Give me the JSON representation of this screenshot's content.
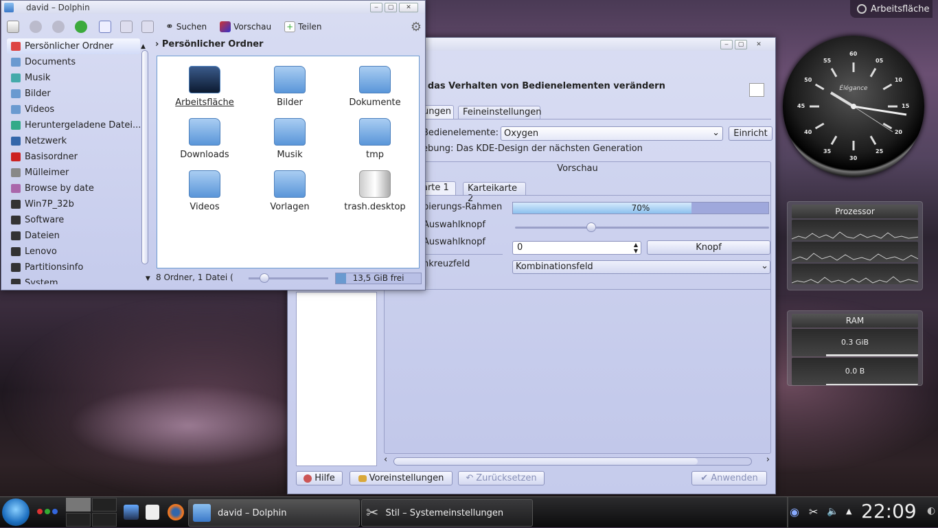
{
  "desktop": {
    "label": "Arbeitsfläche"
  },
  "clock_widget": {
    "brand": "Élégance",
    "numbers": [
      "60",
      "05",
      "10",
      "15",
      "20",
      "25",
      "30",
      "35",
      "40",
      "45",
      "50",
      "55"
    ]
  },
  "processor_widget": {
    "title": "Prozessor"
  },
  "ram_widget": {
    "title": "RAM",
    "values": [
      "0.3 GiB",
      "0.0 B"
    ]
  },
  "settings_window": {
    "heading": "d das Verhalten von Bedienelementen verändern",
    "tabs": [
      "ungen",
      "Feineinstellungen"
    ],
    "style_label": "Bedienelemente:",
    "style_value": "Oxygen",
    "configure_button": "Einricht",
    "description": "ebung: Das KDE-Design der nächsten Generation",
    "preview_title": "Vorschau",
    "preview_tabs": [
      "arte 1",
      "Karteikarte 2"
    ],
    "left_labels": [
      "pierungs-Rahmen",
      "Auswahlknopf",
      "Auswahlknopf",
      "nkreuzfeld"
    ],
    "progress_text": "70%",
    "progress_value": 0.7,
    "slider_value": 0.3,
    "spin_value": "0",
    "button_label": "Knopf",
    "combo_label": "Kombinationsfeld",
    "footer_buttons": [
      "Hilfe",
      "Voreinstellungen",
      "Zurücksetzen",
      "Anwenden"
    ]
  },
  "dolphin": {
    "title": "david – Dolphin",
    "toolbar": {
      "search": "Suchen",
      "preview": "Vorschau",
      "share": "Teilen"
    },
    "breadcrumb": "Persönlicher Ordner",
    "places": [
      "Persönlicher Ordner",
      "Documents",
      "Musik",
      "Bilder",
      "Videos",
      "Heruntergeladene Datei...",
      "Netzwerk",
      "Basisordner",
      "Mülleimer",
      "Browse by date",
      "Win7P_32b",
      "Software",
      "Dateien",
      "Lenovo",
      "Partitionsinfo",
      "System"
    ],
    "items": [
      "Arbeitsfläche",
      "Bilder",
      "Dokumente",
      "Downloads",
      "Musik",
      "tmp",
      "Videos",
      "Vorlagen",
      "trash.desktop"
    ],
    "status": "8 Ordner, 1 Datei (",
    "free_space": "13,5 GiB frei",
    "zoom_value": 0.2,
    "space_used": 0.12
  },
  "taskbar": {
    "tasks": [
      "david – Dolphin",
      "Stil – Systemeinstellungen"
    ],
    "time": "22:09"
  }
}
